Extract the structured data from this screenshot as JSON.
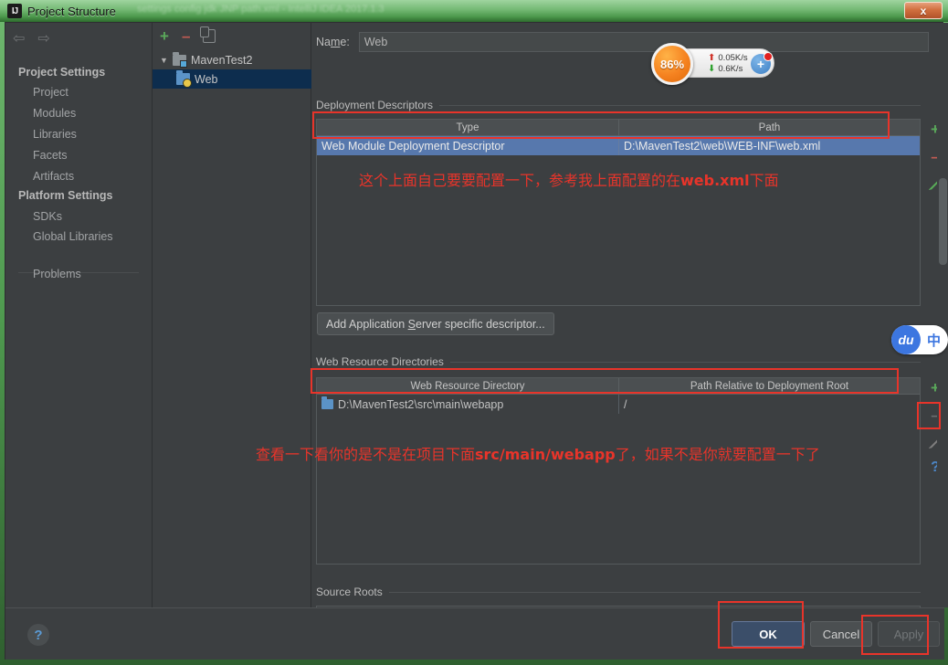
{
  "window": {
    "title": "Project Structure",
    "title_icon": "IJ",
    "ghost_text": "settings config jdk JNP path.xml - IntelliJ IDEA  2017.1.3",
    "close_label": "x"
  },
  "sidebar": {
    "back_icon": "⇦",
    "forward_icon": "⇨",
    "sections": [
      {
        "heading": "Project Settings",
        "items": [
          "Project",
          "Modules",
          "Libraries",
          "Facets",
          "Artifacts"
        ]
      },
      {
        "heading": "Platform Settings",
        "items": [
          "SDKs",
          "Global Libraries"
        ]
      }
    ],
    "problems": "Problems"
  },
  "tree": {
    "toolbar": {
      "add": "+",
      "remove": "–",
      "copy": "copy-icon"
    },
    "nodes": [
      {
        "label": "MavenTest2",
        "expander": "▼",
        "selected": false
      },
      {
        "label": "Web",
        "expander": "",
        "selected": true
      }
    ]
  },
  "content": {
    "name_label_pre": "Na",
    "name_label_mid": "m",
    "name_label_post": "e:",
    "name_value": "Web",
    "name_placeholder": "Web",
    "deployment": {
      "group_title": "Deployment Descriptors",
      "columns": [
        "Type",
        "Path"
      ],
      "rows": [
        {
          "type": "Web Module Deployment Descriptor",
          "path": "D:\\MavenTest2\\web\\WEB-INF\\web.xml",
          "selected": true
        }
      ],
      "side_buttons": {
        "add": "+",
        "remove": "–",
        "edit": "pencil-icon"
      },
      "add_descriptor_button_pre": "Add Application ",
      "add_descriptor_button_key": "S",
      "add_descriptor_button_post": "erver specific descriptor..."
    },
    "web_resources": {
      "group_title": "Web Resource Directories",
      "columns": [
        "Web Resource Directory",
        "Path Relative to Deployment Root"
      ],
      "rows": [
        {
          "directory": "D:\\MavenTest2\\src\\main\\webapp",
          "relative_path": "/"
        }
      ],
      "side_buttons": {
        "add": "+",
        "remove": "–",
        "edit": "pencil-icon",
        "help": "?"
      }
    },
    "source_roots": {
      "group_title": "Source Roots"
    }
  },
  "annotations": {
    "note1": "这个上面自己要要配置一下，参考我上面配置的在web.xml下面",
    "note1_plain_a": "这个上面自己要要配置一下，参考我上面配置的在",
    "note1_bold": "web.xml",
    "note1_plain_b": "下面",
    "note2_plain_a": "查看一下看你的是不是在项目下面",
    "note2_bold": "src/main/webapp",
    "note2_plain_b": "了，如果不是你就要配置一下了",
    "color": "#e8342a"
  },
  "footer": {
    "help": "?",
    "ok": "OK",
    "cancel": "Cancel",
    "apply": "Apply"
  },
  "widgets": {
    "cpu_percent": "86%",
    "upload_speed": "0.05K/s",
    "download_speed": "0.6K/s",
    "upload_arrow": "⬆",
    "download_arrow": "⬇",
    "add_badge": "+",
    "ime_logo": "du",
    "ime_mode": "中"
  },
  "colors": {
    "accent_blue": "#5778ad",
    "annotation_red": "#e8342a",
    "window_green": "#4f9a4f",
    "panel_bg": "#3c3f41"
  }
}
